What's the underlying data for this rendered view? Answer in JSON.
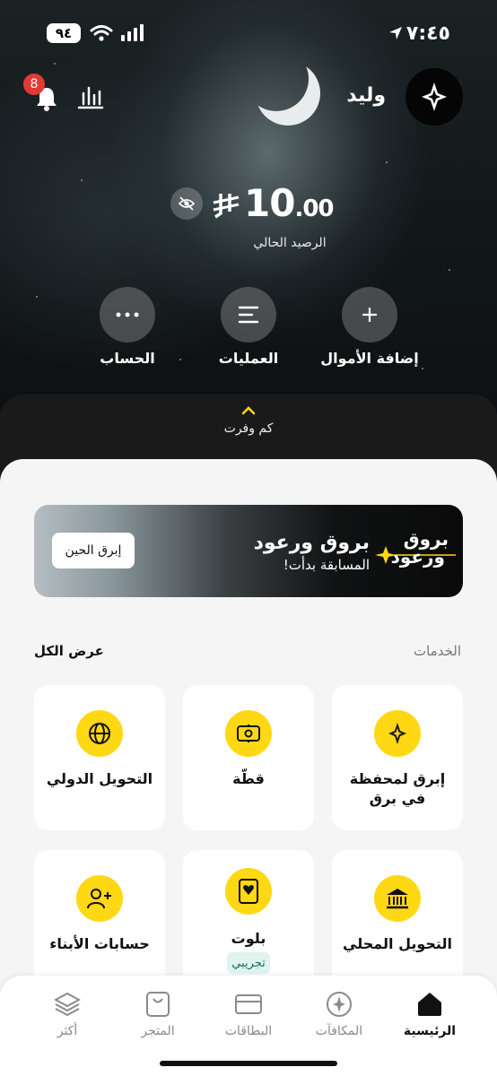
{
  "status_bar": {
    "battery": "٩٤",
    "time": "٧:٤٥"
  },
  "header": {
    "notification_count": "8",
    "user_name": "وليد"
  },
  "balance": {
    "amount_int": "10",
    "amount_dec": ".00",
    "label": "الرصيد الحالي"
  },
  "actions": [
    {
      "label": "الحساب",
      "icon": "more-dots-icon"
    },
    {
      "label": "العمليات",
      "icon": "list-icon"
    },
    {
      "label": "إضافة الأموال",
      "icon": "plus-icon"
    }
  ],
  "savings": {
    "label": "كم وفرت"
  },
  "promo": {
    "button": "إبرق الحين",
    "title": "بروق ورعود",
    "subtitle": "المسابقة بدأت!",
    "logo_line1": "بروق",
    "logo_line2": "ورعود"
  },
  "services": {
    "title": "الخدمات",
    "see_all": "عرض الكل",
    "items": [
      {
        "label": "إبرق لمحفظة في برق",
        "icon": "barq-spark-icon"
      },
      {
        "label": "قطّة",
        "icon": "split-bill-icon"
      },
      {
        "label": "التحويل الدولي",
        "icon": "globe-icon"
      },
      {
        "label": "التحويل المحلي",
        "icon": "bank-icon"
      },
      {
        "label": "بلوت",
        "icon": "playing-card-icon",
        "tag": "تجريبي"
      },
      {
        "label": "حسابات الأبناء",
        "icon": "add-user-icon"
      }
    ]
  },
  "nav": [
    {
      "label": "الرئيسية",
      "active": true
    },
    {
      "label": "المكافآت",
      "active": false
    },
    {
      "label": "البطاقات",
      "active": false
    },
    {
      "label": "المتجر",
      "active": false
    },
    {
      "label": "أكثر",
      "active": false
    }
  ],
  "colors": {
    "accent": "#ffd814",
    "badge": "#e53935"
  }
}
